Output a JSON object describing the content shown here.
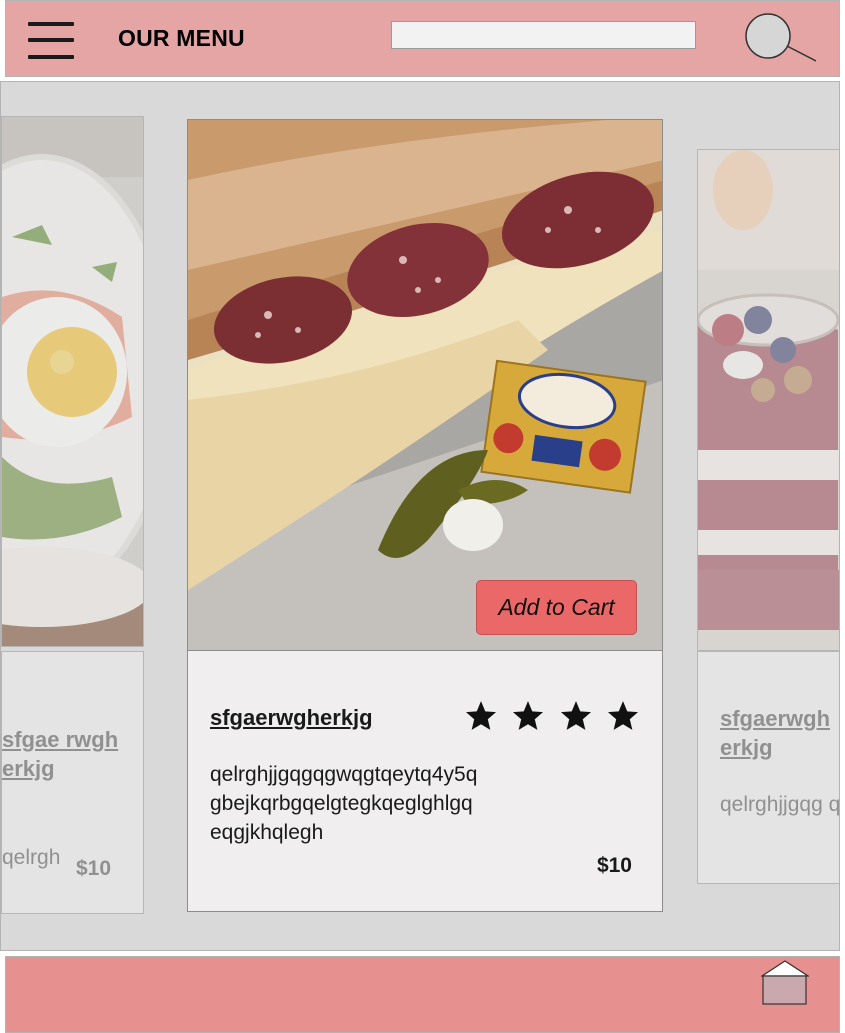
{
  "header": {
    "title": "OUR MENU",
    "search_value": "",
    "menu_icon": "hamburger-menu-icon",
    "search_icon": "search-icon"
  },
  "carousel": {
    "left_card": {
      "name": "sfgae rwgh erkjg",
      "description": "qelrgh",
      "price": "$10",
      "image": "fried-egg-plate"
    },
    "main_card": {
      "name": "sfgaerwgherkjg",
      "description": "qelrghjjgqgqgwqgtqeytq4y5q gbejkqrbgqelgtegkqeglghlgq eqgjkhqlegh",
      "price": "$10",
      "rating": 4,
      "cart_label": "Add to Cart",
      "image": "salami-baguette-sandwich"
    },
    "right_card": {
      "name": "sfgaerwgh erkjg",
      "description": "qelrghjjgqg qgwqgtqeyt",
      "image": "berry-yogurt-parfait"
    }
  },
  "footer": {
    "home_icon": "home-icon"
  },
  "colors": {
    "header_bg": "#e6a5a5",
    "footer_bg": "#e6908f",
    "button_bg": "#ea6868",
    "content_bg": "#d9d9d9",
    "card_bg": "#f0eeee"
  }
}
